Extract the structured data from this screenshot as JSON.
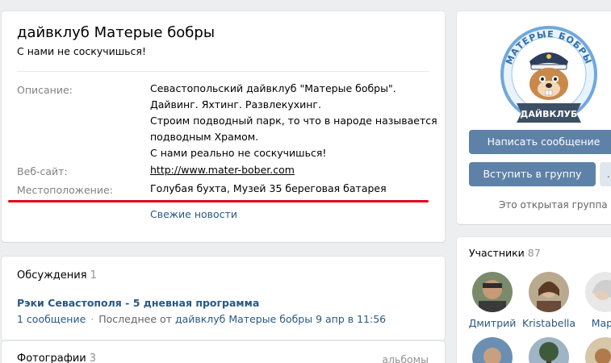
{
  "group": {
    "name": "дайвклуб Матерые бобры",
    "status": "С нами не соскучишься!"
  },
  "info": {
    "description_label": "Описание:",
    "description_lines": [
      "Севастопольский дайвклуб \"Матерые бобры\".",
      "Дайвинг. Яхтинг. Развлекухинг.",
      "Строим подводный парк, то что в народе называется",
      "подводным Храмом.",
      "С нами реально не соскучишься!"
    ],
    "website_label": "Веб-сайт:",
    "website_value": "http://www.mater-bober.com",
    "location_label": "Местоположение:",
    "location_value": "Голубая бухта, Музей 35 береговая батарея",
    "news_link": "Свежие новости"
  },
  "discussions": {
    "title": "Обсуждения",
    "count": "1",
    "topic_title": "Рэки Севастополя - 5 дневная программа",
    "topic_messages": "1 сообщение",
    "topic_last_prefix": "Последнее от",
    "topic_last_author": "дайвклуб Матерые бобры",
    "topic_last_date": "9 апр в 11:56"
  },
  "photos": {
    "title": "Фотографии",
    "count": "3",
    "albums_link": "альбомы"
  },
  "side": {
    "logo_top_text": "МАТЕРЫЕ БОБРЫ",
    "logo_banner_text": "ДАЙВКЛУБ",
    "message_button": "Написать сообщение",
    "join_button": "Вступить в группу",
    "more_button": "…",
    "open_group": "Это открытая группа"
  },
  "members": {
    "title": "Участники",
    "count": "87",
    "list": [
      {
        "name": "Дмитрий"
      },
      {
        "name": "Kristabella"
      },
      {
        "name": "Мари"
      }
    ]
  },
  "colors": {
    "accent": "#5e81a8",
    "link": "#2a5885",
    "highlight_underline": "#e2001a"
  }
}
